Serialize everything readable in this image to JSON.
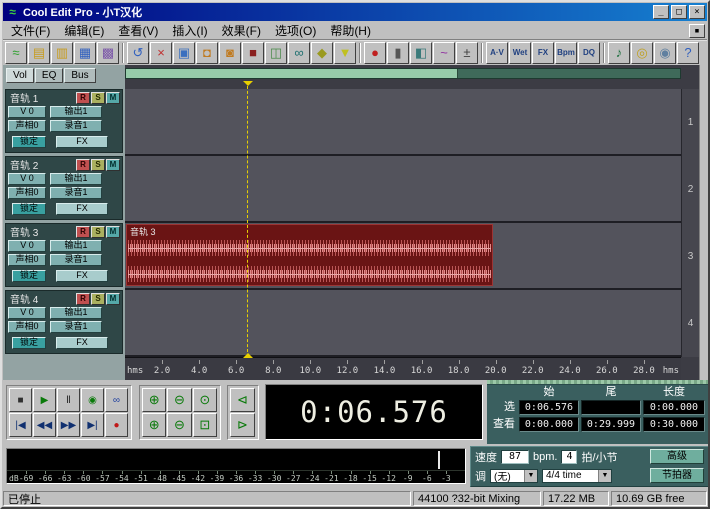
{
  "window": {
    "title": "Cool Edit Pro - 小T汉化",
    "app_icon": "≈"
  },
  "titlebar": {
    "minimize": "_",
    "maximize": "□",
    "close": "×"
  },
  "icons": {
    "dropdown_arrow": "▼",
    "mdi_button": "▪"
  },
  "menu": {
    "items": [
      {
        "id": "file",
        "label": "文件(F)"
      },
      {
        "id": "edit",
        "label": "编辑(E)"
      },
      {
        "id": "view",
        "label": "查看(V)"
      },
      {
        "id": "insert",
        "label": "插入(I)"
      },
      {
        "id": "effects",
        "label": "效果(F)"
      },
      {
        "id": "options",
        "label": "选项(O)"
      },
      {
        "id": "help",
        "label": "帮助(H)"
      }
    ]
  },
  "toolbar": {
    "groups": [
      [
        {
          "name": "waveform-view-icon",
          "glyph": "≈",
          "color": "#2ba02b"
        },
        {
          "name": "open-file-icon",
          "glyph": "▤",
          "color": "#c79c1e"
        },
        {
          "name": "open-session-icon",
          "glyph": "▥",
          "color": "#c79c1e"
        },
        {
          "name": "save-icon",
          "glyph": "▦",
          "color": "#2f5fbf"
        },
        {
          "name": "mixer-icon",
          "glyph": "▩",
          "color": "#7a55a8"
        }
      ],
      [
        {
          "name": "undo-icon",
          "glyph": "↺",
          "color": "#2f5fbf"
        },
        {
          "name": "cut-icon",
          "glyph": "×",
          "color": "#c03030"
        },
        {
          "name": "copy-icon",
          "glyph": "▣",
          "color": "#3a6fbf"
        },
        {
          "name": "paste-icon",
          "glyph": "◘",
          "color": "#c07a20"
        },
        {
          "name": "mix-paste-icon",
          "glyph": "◙",
          "color": "#c07a20"
        },
        {
          "name": "delete-icon",
          "glyph": "■",
          "color": "#8a2020"
        },
        {
          "name": "crop-icon",
          "glyph": "◫",
          "color": "#4a8a4a"
        },
        {
          "name": "loop-duplicate-icon",
          "glyph": "∞",
          "color": "#1f7070"
        },
        {
          "name": "group-clips-icon",
          "glyph": "◆",
          "color": "#9a9a20"
        },
        {
          "name": "marker-icon",
          "glyph": "▼",
          "color": "#c0c020"
        }
      ],
      [
        {
          "name": "punch-in-icon",
          "glyph": "●",
          "color": "#c02020"
        },
        {
          "name": "mute-clip-icon",
          "glyph": "▮",
          "color": "#555555"
        },
        {
          "name": "lock-time-icon",
          "glyph": "◧",
          "color": "#3a7a7a"
        },
        {
          "name": "envelope-icon",
          "glyph": "~",
          "color": "#9030a0"
        },
        {
          "name": "snapping-icon",
          "glyph": "±",
          "color": "#404040"
        }
      ],
      [
        {
          "name": "av-sync-icon",
          "glyph": "A·V",
          "color": "#204080"
        },
        {
          "name": "wet-dry-icon",
          "glyph": "Wet",
          "color": "#204080"
        },
        {
          "name": "fx-rack-icon",
          "glyph": "FX",
          "color": "#204080"
        },
        {
          "name": "bpm-icon",
          "glyph": "Bpm",
          "color": "#204080"
        },
        {
          "name": "quantize-icon",
          "glyph": "DQ",
          "color": "#204080"
        }
      ],
      [
        {
          "name": "metronome-icon",
          "glyph": "♪",
          "color": "#1f7040"
        },
        {
          "name": "cd-burn-icon",
          "glyph": "◎",
          "color": "#c0a020"
        },
        {
          "name": "scripts-icon",
          "glyph": "◉",
          "color": "#6080a0"
        },
        {
          "name": "help-icon",
          "glyph": "?",
          "color": "#2f5fbf"
        }
      ]
    ]
  },
  "track_panel": {
    "tabs": [
      {
        "id": "vol",
        "label": "Vol",
        "active": true
      },
      {
        "id": "eq",
        "label": "EQ",
        "active": false
      },
      {
        "id": "bus",
        "label": "Bus",
        "active": false
      }
    ],
    "tracks": [
      {
        "label": "音轨 1",
        "record_arm": "R",
        "solo": "S",
        "mute": "M",
        "volume": "V 0",
        "output": "输出1",
        "pan": "声相0",
        "record_device": "录音1",
        "lock": "锁定",
        "fx": "FX"
      },
      {
        "label": "音轨 2",
        "record_arm": "R",
        "solo": "S",
        "mute": "M",
        "volume": "V 0",
        "output": "输出1",
        "pan": "声相0",
        "record_device": "录音1",
        "lock": "锁定",
        "fx": "FX"
      },
      {
        "label": "音轨 3",
        "record_arm": "R",
        "solo": "S",
        "mute": "M",
        "volume": "V 0",
        "output": "输出1",
        "pan": "声相0",
        "record_device": "录音1",
        "lock": "锁定",
        "fx": "FX"
      },
      {
        "label": "音轨 4",
        "record_arm": "R",
        "solo": "S",
        "mute": "M",
        "volume": "V 0",
        "output": "输出1",
        "pan": "声相0",
        "record_device": "录音1",
        "lock": "锁定",
        "fx": "FX"
      }
    ]
  },
  "timeline": {
    "unit": "hms",
    "total_seconds": 30,
    "ticks": [
      2,
      4,
      6,
      8,
      10,
      12,
      14,
      16,
      18,
      20,
      22,
      24,
      26,
      28
    ],
    "track_numbers": [
      "1",
      "2",
      "3",
      "4"
    ],
    "playhead_seconds": 6.576,
    "clip": {
      "track_index": 2,
      "label": "音轨 3",
      "start_seconds": 0,
      "end_seconds": 19.8
    }
  },
  "transport": {
    "rows": [
      [
        {
          "name": "stop-button",
          "glyph": "■",
          "color": "#303030"
        },
        {
          "name": "play-button",
          "glyph": "▶",
          "color": "#0a7a0a"
        },
        {
          "name": "pause-button",
          "glyph": "Ⅱ",
          "color": "#303030"
        },
        {
          "name": "play-looped-button",
          "glyph": "◉",
          "color": "#0a7a0a"
        },
        {
          "name": "loop-button",
          "glyph": "∞",
          "color": "#1f3fa0"
        }
      ],
      [
        {
          "name": "go-to-start-button",
          "glyph": "|◀",
          "color": "#103070"
        },
        {
          "name": "rewind-button",
          "glyph": "◀◀",
          "color": "#103070"
        },
        {
          "name": "fast-forward-button",
          "glyph": "▶▶",
          "color": "#103070"
        },
        {
          "name": "go-to-end-button",
          "glyph": "▶|",
          "color": "#103070"
        },
        {
          "name": "record-button",
          "glyph": "●",
          "color": "#c01818"
        }
      ]
    ]
  },
  "zoom": {
    "main": [
      [
        {
          "name": "zoom-in-button",
          "glyph": "⊕"
        },
        {
          "name": "zoom-out-button",
          "glyph": "⊖"
        },
        {
          "name": "zoom-full-button",
          "glyph": "⊙"
        }
      ],
      [
        {
          "name": "zoom-in-vertical-button",
          "glyph": "⊕"
        },
        {
          "name": "zoom-out-vertical-button",
          "glyph": "⊖"
        },
        {
          "name": "zoom-selection-button",
          "glyph": "⊡"
        }
      ]
    ],
    "edge": [
      [
        {
          "name": "zoom-left-edge-button",
          "glyph": "⊲"
        }
      ],
      [
        {
          "name": "zoom-right-edge-button",
          "glyph": "⊳"
        }
      ]
    ]
  },
  "time_display": {
    "value": "0:06.576"
  },
  "selection_panel": {
    "headers": [
      "始",
      "尾",
      "长度"
    ],
    "rows": [
      {
        "id": "selection",
        "label": "选",
        "cells": [
          "0:06.576",
          "",
          "0:00.000"
        ]
      },
      {
        "id": "view",
        "label": "查看",
        "cells": [
          "0:00.000",
          "0:29.999",
          "0:30.000"
        ]
      }
    ]
  },
  "meter": {
    "unit": "dB",
    "range": [
      -72,
      0
    ],
    "scale": [
      -69,
      -66,
      -63,
      -60,
      -57,
      -54,
      -51,
      -48,
      -45,
      -42,
      -39,
      -36,
      -33,
      -30,
      -27,
      -24,
      -21,
      -18,
      -15,
      -12,
      -9,
      -6,
      -3
    ]
  },
  "tempo": {
    "speed_label": "速度",
    "speed": "87",
    "speed_unit": "bpm.",
    "beats": "4",
    "beats_label": "拍/小节",
    "key_label": "调",
    "key": "(无)",
    "time_signature": "4/4 time",
    "advanced_label": "高级",
    "metronome_label": "节拍器"
  },
  "status": {
    "state": "已停止",
    "format": "44100 ?32-bit Mixing",
    "memory": "17.22 MB",
    "disk": "10.69 GB free"
  },
  "colors": {
    "titlebar_from": "#000080",
    "titlebar_to": "#1680d0",
    "panel_teal": "#3a5f5f",
    "clip_red": "#6a1414",
    "lane_gray": "#53535c",
    "playhead_yellow": "#e8d000"
  }
}
